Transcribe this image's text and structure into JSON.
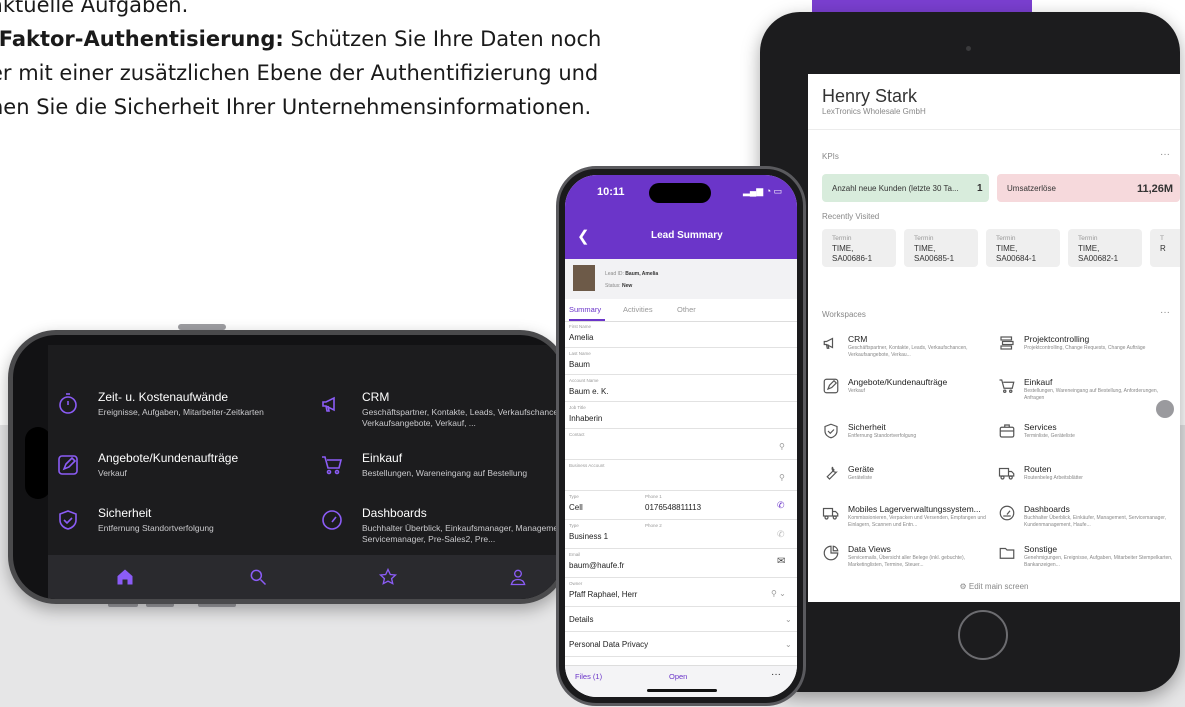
{
  "intro": {
    "line1": "aktuelle Aufgaben.",
    "bold": "-Faktor-Authentisierung:",
    "line2_rest": " Schützen Sie Ihre Daten noch",
    "line3": "er mit einer zusätzlichen Ebene der Authentifizierung und",
    "line4": "hen Sie die Sicherheit Ihrer Unternehmensinformationen."
  },
  "tablet": {
    "user_name": "Henry Stark",
    "company": "LexTronics Wholesale GmbH",
    "kpis_title": "KPIs",
    "more": "···",
    "kpis": [
      {
        "label": "Anzahl neue Kunden (letzte 30 Ta...",
        "value": "1"
      },
      {
        "label": "Umsatzerlöse",
        "value": "11,26M"
      }
    ],
    "recently_visited_title": "Recently Visited",
    "recently_visited": [
      {
        "type": "Termin",
        "line1": "TIME,",
        "line2": "SA00686-1"
      },
      {
        "type": "Termin",
        "line1": "TIME,",
        "line2": "SA00685-1"
      },
      {
        "type": "Termin",
        "line1": "TIME,",
        "line2": "SA00684-1"
      },
      {
        "type": "Termin",
        "line1": "TIME,",
        "line2": "SA00682-1"
      },
      {
        "type": "T",
        "line1": "R",
        "line2": ""
      }
    ],
    "workspaces_title": "Workspaces",
    "workspaces": [
      {
        "title": "CRM",
        "desc": "Geschäftspartner, Kontakte, Leads, Verkaufschancen, Verkaufsangebote, Verkau..."
      },
      {
        "title": "Projektcontrolling",
        "desc": "Projektcontrolling, Change Requests, Change Aufträge"
      },
      {
        "title": "Angebote/Kundenaufträge",
        "desc": "Verkauf"
      },
      {
        "title": "Einkauf",
        "desc": "Bestellungen, Wareneingang auf Bestellung, Anforderungen, Anfragen"
      },
      {
        "title": "Sicherheit",
        "desc": "Entfernung Standortverfolgung"
      },
      {
        "title": "Services",
        "desc": "Terminliste, Geräteliste"
      },
      {
        "title": "Geräte",
        "desc": "Geräteliste"
      },
      {
        "title": "Routen",
        "desc": "Routenbeleg Arbeitsblätter"
      },
      {
        "title": "Mobiles Lagerverwaltungssystem...",
        "desc": "Kommissionieren, Verpacken und Versenden, Empfangen und Einlagern, Scannen und Entn..."
      },
      {
        "title": "Dashboards",
        "desc": "Buchhalter Überblick, Einkäufer, Management, Servicemanager, Kundenmanagement, Haufe..."
      },
      {
        "title": "Data Views",
        "desc": "Servicemails, Übersicht aller Belege (inkl. gebuchte), Marketinglisten, Termine, Steuer..."
      },
      {
        "title": "Sonstige",
        "desc": "Genehmigungen, Ereignisse, Aufgaben, Mitarbeiter Stempelkarten, Bankanzeigen..."
      }
    ],
    "edit_main": "Edit main screen"
  },
  "landscape": {
    "items": [
      {
        "title": "Zeit- u. Kostenaufwände",
        "desc": "Ereignisse, Aufgaben, Mitarbeiter-Zeitkarten"
      },
      {
        "title": "CRM",
        "desc": "Geschäftspartner, Kontakte, Leads, Verkaufschancen, Verkaufsangebote, Verkauf, ..."
      },
      {
        "title": "Angebote/Kundenaufträge",
        "desc": "Verkauf"
      },
      {
        "title": "Einkauf",
        "desc": "Bestellungen, Wareneingang auf Bestellung"
      },
      {
        "title": "Sicherheit",
        "desc": "Entfernung Standortverfolgung"
      },
      {
        "title": "Dashboards",
        "desc": "Buchhalter Überblick, Einkaufsmanager, Management, Servicemanager, Pre-Sales2, Pre..."
      }
    ]
  },
  "portrait": {
    "time": "10:11",
    "title": "Lead Summary",
    "lead_id_label": "Lead ID:",
    "lead_id_value": "Baum, Amelia",
    "status_label": "Status:",
    "status_value": "New",
    "tabs": [
      "Summary",
      "Activities",
      "Other"
    ],
    "fields": [
      {
        "label": "First Name",
        "value": "Amelia"
      },
      {
        "label": "Last Name",
        "value": "Baum"
      },
      {
        "label": "Account Name",
        "value": "Baum e. K."
      },
      {
        "label": "Job Title",
        "value": "Inhaberin"
      },
      {
        "label": "Contact",
        "value": ""
      },
      {
        "label": "Business Account",
        "value": ""
      }
    ],
    "phone1_type_label": "Type",
    "phone1_type": "Cell",
    "phone1_label": "Phone 1",
    "phone1_value": "0176548811113",
    "phone2_type_label": "Type",
    "phone2_type": "Business 1",
    "phone2_label": "Phone 2",
    "email_label": "Email",
    "email_value": "baum@haufe.fr",
    "owner_label": "Owner",
    "owner_value": "Pfaff Raphael, Herr",
    "details": "Details",
    "privacy": "Personal Data Privacy",
    "files": "Files (1)",
    "open": "Open",
    "more": "···"
  },
  "colors": {
    "brand_purple": "#6b35c9",
    "kpi_green": "#d8ecdc",
    "kpi_red": "#f6d9dc"
  }
}
